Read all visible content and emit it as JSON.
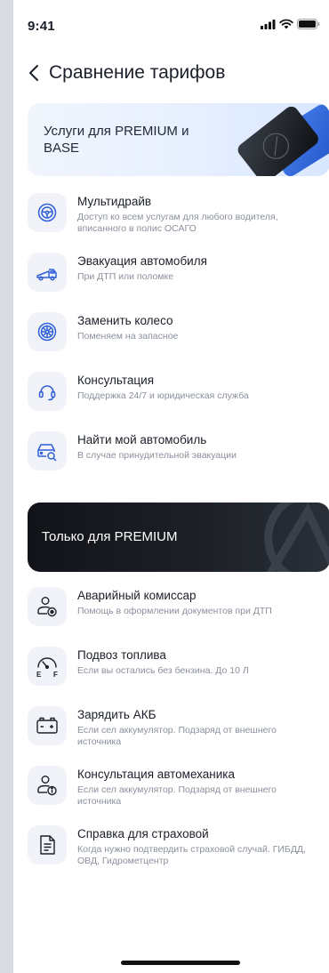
{
  "status_bar": {
    "time": "9:41"
  },
  "header": {
    "title": "Сравнение тарифов"
  },
  "banner_top": {
    "text": "Услуги для PREMIUM и BASE"
  },
  "base_services": [
    {
      "icon": "steering-wheel-icon",
      "title": "Мультидрайв",
      "subtitle": "Доступ ко всем услугам для любого водителя, вписанного в полис ОСАГО"
    },
    {
      "icon": "tow-truck-icon",
      "title": "Эвакуация автомобиля",
      "subtitle": "При ДТП или поломке"
    },
    {
      "icon": "wheel-icon",
      "title": "Заменить колесо",
      "subtitle": "Поменяем на запасное"
    },
    {
      "icon": "headset-icon",
      "title": "Консультация",
      "subtitle": "Поддержка 24/7 и юридическая служба"
    },
    {
      "icon": "car-search-icon",
      "title": "Найти мой автомобиль",
      "subtitle": "В случае принудительной эвакуации"
    }
  ],
  "banner_premium": {
    "text": "Только для PREMIUM"
  },
  "premium_services": [
    {
      "icon": "commissioner-icon",
      "title": "Аварийный комиссар",
      "subtitle": "Помощь в оформлении документов при ДТП"
    },
    {
      "icon": "fuel-gauge-icon",
      "title": "Подвоз топлива",
      "subtitle": "Если вы остались без бензина. До 10 Л"
    },
    {
      "icon": "battery-icon",
      "title": "Зарядить АКБ",
      "subtitle": "Если сел аккумулятор. Подзаряд от внешнего источника"
    },
    {
      "icon": "mechanic-info-icon",
      "title": "Консультация автомеханика",
      "subtitle": "Если сел аккумулятор. Подзаряд от внешнего источника"
    },
    {
      "icon": "document-icon",
      "title": "Справка для страховой",
      "subtitle": "Когда нужно подтвердить страховой случай. ГИБДД, ОВД, Гидрометцентр"
    }
  ],
  "colors": {
    "accent": "#2f5fd8",
    "text": "#1b1f2a",
    "muted": "#8a909c",
    "icon_bg": "#f1f3f8"
  }
}
